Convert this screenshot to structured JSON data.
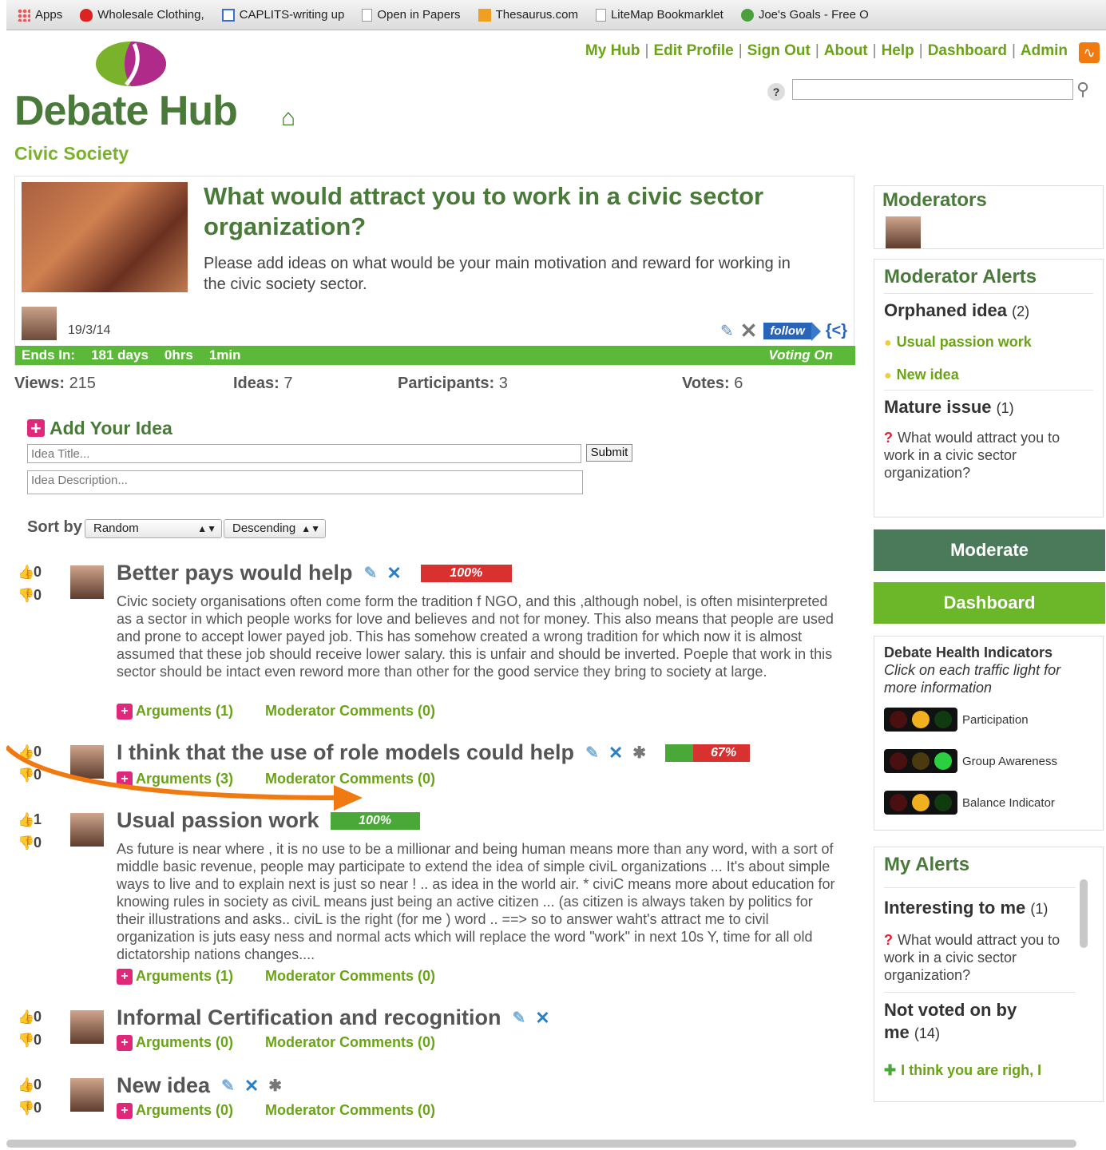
{
  "bookmarks": [
    {
      "label": "Apps",
      "icon": "apps-grid-icon"
    },
    {
      "label": "Wholesale Clothing,",
      "icon": "tulip-icon"
    },
    {
      "label": "CAPLITS-writing up",
      "icon": "window-icon"
    },
    {
      "label": "Open in Papers",
      "icon": "document-icon"
    },
    {
      "label": "Thesaurus.com",
      "icon": "thesaurus-icon"
    },
    {
      "label": "LiteMap Bookmarklet",
      "icon": "document-icon"
    },
    {
      "label": "Joe's Goals - Free O",
      "icon": "checkmark-icon"
    }
  ],
  "topnav": [
    "My Hub",
    "Edit Profile",
    "Sign Out",
    "About",
    "Help",
    "Dashboard",
    "Admin"
  ],
  "search": {
    "help_label": "?",
    "placeholder": ""
  },
  "logo": {
    "title": "Debate Hub"
  },
  "group_name": "Civic Society",
  "issue": {
    "title": "What would attract you to work in a civic sector organization?",
    "description": "Please add ideas on what would be your main motivation and reward for working in the civic society sector.",
    "date": "19/3/14",
    "follow_label": "follow",
    "embed_label": "{<}",
    "ends_in_label": "Ends In:",
    "days": "181 days",
    "hours": "0hrs",
    "minutes": "1min",
    "voting_label": "Voting On"
  },
  "stats": {
    "views_label": "Views:",
    "views": "215",
    "ideas_label": "Ideas:",
    "ideas": "7",
    "participants_label": "Participants:",
    "participants": "3",
    "votes_label": "Votes:",
    "votes": "6"
  },
  "add_idea": {
    "heading": "Add Your Idea",
    "title_placeholder": "Idea Title...",
    "desc_placeholder": "Idea Description...",
    "submit_label": "Submit"
  },
  "sort": {
    "label": "Sort by",
    "field": "Random",
    "order": "Descending"
  },
  "ideas": [
    {
      "up": "0",
      "down": "0",
      "title": "Better pays would help",
      "percent": "100%",
      "percent_value": 1.0,
      "bar_color": "#d93030",
      "fill_color": "#d93030",
      "body": "Civic society organisations often come form the tradition f NGO, and this ,although nobel, is often misinterpreted as a sector in which people works for love and believes and not for money. This also means that people are used and prone to accept lower payed job. This has somehow created a wrong tradition for which now it is almost assumed that these job should receive lower salary. this is unfair and should be inverted. Poeple that work in this sector should be intact even reword more than other for the good service they bring to society at large.",
      "arguments": "Arguments (1)",
      "comments": "Moderator Comments (0)"
    },
    {
      "up": "0",
      "down": "0",
      "title": "I think that the use of role models could help",
      "percent": "67%",
      "percent_value": 0.33,
      "bar_color": "#d93030",
      "fill_color": "#4aa838",
      "body": "",
      "arguments": "Arguments (3)",
      "comments": "Moderator Comments (0)"
    },
    {
      "up": "1",
      "down": "0",
      "title": "Usual passion work",
      "percent": "100%",
      "percent_value": 1.0,
      "bar_color": "#4aa838",
      "fill_color": "#4aa838",
      "body": "As future is near where , it is no use to be a millionar and being human means more than any word, with a sort of middle basic revenue, people may participate to extend the idea of simple civiL organizations ... It's about simple ways to live and to explain next is just so near ! .. as idea in the world air. * civiC means more about education for knowing rules in society as civiL means just being an active citizen ... (as citizen is always taken by politics for their illustrations and asks.. civiL is the right (for me ) word .. ==> so to answer waht's attract me to civil organization is juts easy ness and normal acts which will replace the word \"work\" in next 10s Y, time for all old dictatorship nations changes....",
      "arguments": "Arguments (1)",
      "comments": "Moderator Comments (0)"
    },
    {
      "up": "0",
      "down": "0",
      "title": "Informal Certification and recognition",
      "percent": "",
      "body": "",
      "arguments": "Arguments (0)",
      "comments": "Moderator Comments (0)"
    },
    {
      "up": "0",
      "down": "0",
      "title": "New idea",
      "percent": "",
      "body": "",
      "arguments": "Arguments (0)",
      "comments": "Moderator Comments (0)"
    }
  ],
  "sidebar": {
    "moderators_heading": "Moderators",
    "alerts_heading": "Moderator Alerts",
    "orphaned_label": "Orphaned idea",
    "orphaned_count": "(2)",
    "orphaned_items": [
      "Usual passion work",
      "New idea"
    ],
    "mature_label": "Mature issue",
    "mature_count": "(1)",
    "mature_item": "What would attract you to work in a civic sector organization?",
    "moderate_label": "Moderate",
    "dashboard_label": "Dashboard",
    "health_heading": "Debate Health Indicators",
    "health_note": "Click on each traffic light for more information",
    "indicators": [
      {
        "label": "Participation",
        "active": "amber"
      },
      {
        "label": "Group Awareness",
        "active": "green"
      },
      {
        "label": "Balance Indicator",
        "active": "amber"
      }
    ],
    "my_alerts_heading": "My Alerts",
    "interesting_label": "Interesting to me",
    "interesting_count": "(1)",
    "interesting_item": "What would attract you to work in a civic sector organization?",
    "notvoted_label": "Not voted on by me",
    "notvoted_count": "(14)",
    "notvoted_item": "I think you are righ, I"
  },
  "colors": {
    "brand_green": "#4a7a3a",
    "link_green": "#6aa416",
    "moderate_bg": "#4a7a5a",
    "dashboard_bg": "#6cb62a",
    "annotation_arrow": "#f07a10"
  }
}
